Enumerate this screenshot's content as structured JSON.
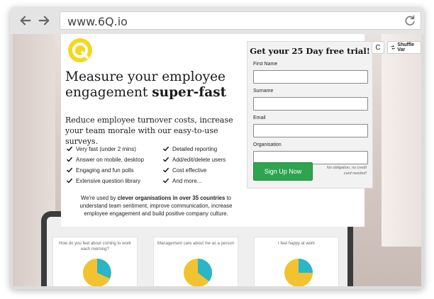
{
  "browser": {
    "url": "www.6Q.io"
  },
  "widgets": {
    "c_button": "C",
    "shuffle_label": "Shuffle Var"
  },
  "hero": {
    "headline_regular": "Measure your employee engagement ",
    "headline_bold": "super-fast",
    "subhead": "Reduce employee turnover costs, increase your team morale with our easy-to-use surveys."
  },
  "features": [
    "Very fast (under 2 mins)",
    "Detailed reporting",
    "Answer on mobile, desktop",
    "Add/edit/delete users",
    "Engaging and fun polls",
    "Cost effective",
    "Extensive question library",
    "And more..."
  ],
  "used_by": {
    "prefix": "We're used by ",
    "bold": "clever organisations in over 35 countries",
    "suffix": " to understand team sentiment, improve communication, increase employee engagement and build positive company culture."
  },
  "form": {
    "title": "Get your 25 Day free trial!",
    "fields": [
      {
        "label": "First Name",
        "value": ""
      },
      {
        "label": "Surname",
        "value": ""
      },
      {
        "label": "Email",
        "value": ""
      },
      {
        "label": "Organisation",
        "value": ""
      }
    ],
    "submit_label": "Sign Up Now",
    "note": "No obligation, no credit card needed!"
  },
  "background_polls": [
    {
      "question": "How do you feel about coming to work each morning?"
    },
    {
      "question": "Management care about me as a person"
    },
    {
      "question": "I feel happy at work"
    }
  ],
  "colors": {
    "brand_yellow": "#f5d81c",
    "signup_green": "#2ea44f",
    "poll_teal": "#29b6c6",
    "poll_yellow": "#f2c230"
  },
  "icons": {
    "logo": "6q-logo-icon",
    "back": "back-arrow-icon",
    "forward": "forward-arrow-icon",
    "reload": "reload-icon",
    "check": "check-icon",
    "shuffle": "shuffle-icon"
  }
}
